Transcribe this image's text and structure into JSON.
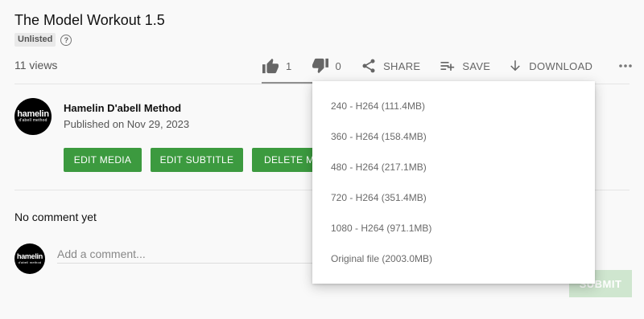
{
  "video": {
    "title": "The Model Workout 1.5",
    "visibility_badge": "Unlisted",
    "help_glyph": "?",
    "views": "11 views"
  },
  "actions": {
    "like_count": "1",
    "dislike_count": "0",
    "share_label": "SHARE",
    "save_label": "SAVE",
    "download_label": "DOWNLOAD"
  },
  "channel": {
    "name": "Hamelin D'abell Method",
    "published": "Published on Nov 29, 2023",
    "avatar_line1": "hamelin",
    "avatar_line2": "d'abell method"
  },
  "media_buttons": {
    "edit_media": "EDIT MEDIA",
    "edit_subtitle": "EDIT SUBTITLE",
    "delete_media": "DELETE MEDIA"
  },
  "comments": {
    "empty_text": "No comment yet",
    "placeholder": "Add a comment...",
    "submit_label": "SUBMIT"
  },
  "download_menu": {
    "items": [
      "240 - H264 (111.4MB)",
      "360 - H264 (158.4MB)",
      "480 - H264 (217.1MB)",
      "720 - H264 (351.4MB)",
      "1080 - H264 (971.1MB)",
      "Original file (2003.0MB)"
    ]
  },
  "colors": {
    "accent_green": "#3c9a3f",
    "submit_disabled": "#cfe6cf"
  }
}
